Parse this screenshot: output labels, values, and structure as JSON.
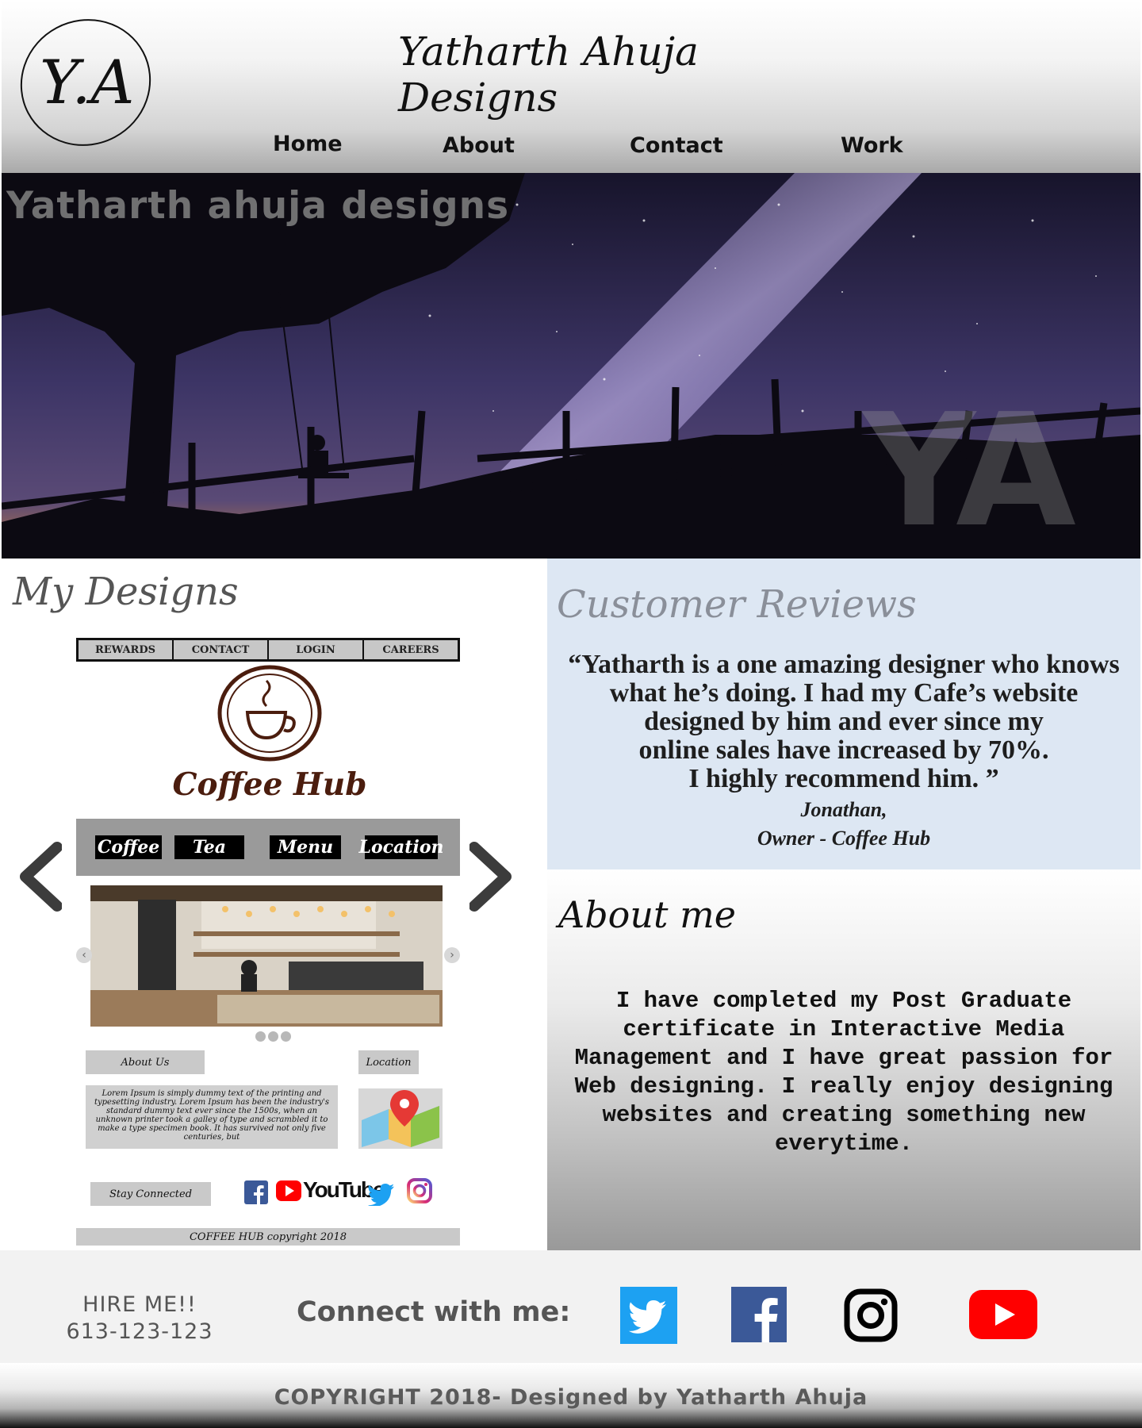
{
  "header": {
    "logo_text": "Y.A",
    "title": "Yatharth Ahuja Designs",
    "nav": [
      "Home",
      "About",
      "Contact",
      "Work"
    ]
  },
  "hero": {
    "overlay_text": "Yatharth ahuja designs",
    "watermark": "YA"
  },
  "designs": {
    "title": "My Designs",
    "mock": {
      "top_nav": [
        "REWARDS",
        "CONTACT",
        "LOGIN",
        "CAREERS"
      ],
      "brand": "Coffee Hub",
      "menu": [
        "Coffee",
        "Tea",
        "Menu",
        "Location"
      ],
      "about_label": "About Us",
      "location_label": "Location",
      "lorem": "Lorem Ipsum is simply dummy text of the printing and typesetting industry. Lorem Ipsum has been the industry's standard dummy text ever since the 1500s, when an unknown printer took a galley of type and scrambled it to make a type specimen book. It has survived not only five centuries, but",
      "stay_connected": "Stay Connected",
      "youtube_text": "YouTube",
      "copyright": "COFFEE HUB copyright 2018"
    }
  },
  "reviews": {
    "title": "Customer Reviews",
    "quote_lines": [
      "“Yatharth is a one amazing designer who knows",
      "what he’s doing. I had my Cafe’s website",
      "designed by him and ever since my",
      "online sales have increased by 70%.",
      "I highly recommend him. ”"
    ],
    "author": "Jonathan,",
    "author_role": "Owner - Coffee Hub"
  },
  "about": {
    "title": "About me",
    "lines": [
      "I have completed my Post Graduate",
      "certificate in Interactive Media",
      "Management and I have great passion for",
      "Web designing. I really enjoy designing",
      "websites and creating something new",
      "everytime."
    ]
  },
  "contact": {
    "hire": "HIRE ME!!",
    "phone": "613-123-123",
    "connect_label": "Connect with me:",
    "social_icons": [
      "twitter-icon",
      "facebook-icon",
      "instagram-icon",
      "youtube-icon"
    ]
  },
  "footer": {
    "copyright": "COPYRIGHT 2018- Designed by Yatharth Ahuja"
  },
  "colors": {
    "reviews_bg": "#dde7f3",
    "coffee_brown": "#4b1d0e",
    "twitter": "#1da1f2",
    "facebook": "#3b5998",
    "youtube": "#ff0000"
  }
}
